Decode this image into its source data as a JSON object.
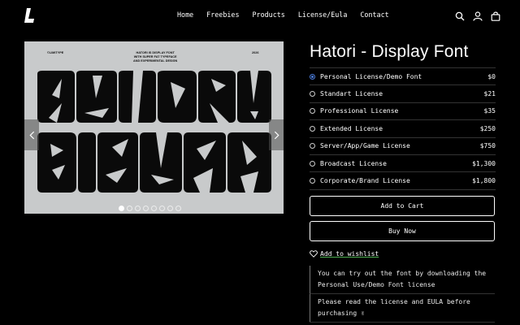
{
  "header": {
    "nav": [
      "Home",
      "Freebies",
      "Products",
      "License/Eula",
      "Contact"
    ],
    "icons": [
      "search-icon",
      "account-icon",
      "cart-icon"
    ]
  },
  "gallery": {
    "poster": {
      "brand": "©LIMITYPE",
      "blurb_1": "HATORI IS DISPLAY FONT",
      "blurb_2": "WITH SUPER FAT TYPEFACE",
      "blurb_3": "AND EXPERIMENTAL DESIGN",
      "year": "2026",
      "word_1": "HATORI",
      "word_2": "BISTAN"
    },
    "slide_count": 8,
    "active_slide": 0
  },
  "product": {
    "title": "Hatori - Display Font",
    "options": [
      {
        "name": "Personal License/Demo Font",
        "price": "$0",
        "selected": true
      },
      {
        "name": "Standart License",
        "price": "$21",
        "selected": false
      },
      {
        "name": "Professional License",
        "price": "$35",
        "selected": false
      },
      {
        "name": "Extended License",
        "price": "$250",
        "selected": false
      },
      {
        "name": "Server/App/Game License",
        "price": "$750",
        "selected": false
      },
      {
        "name": "Broadcast License",
        "price": "$1,300",
        "selected": false
      },
      {
        "name": "Corporate/Brand License",
        "price": "$1,800",
        "selected": false
      }
    ],
    "add_to_cart": "Add to Cart",
    "buy_now": "Buy Now",
    "wishlist": "Add to wishlist",
    "note_1": "You can try out the font by downloading the Personal Use/Demo Font license",
    "note_2": "Please read the license and EULA before purchasing ✌"
  },
  "colors": {
    "background": "#000000",
    "accent_radio": "#4a7bd9",
    "poster_bg": "#c8cacb"
  }
}
